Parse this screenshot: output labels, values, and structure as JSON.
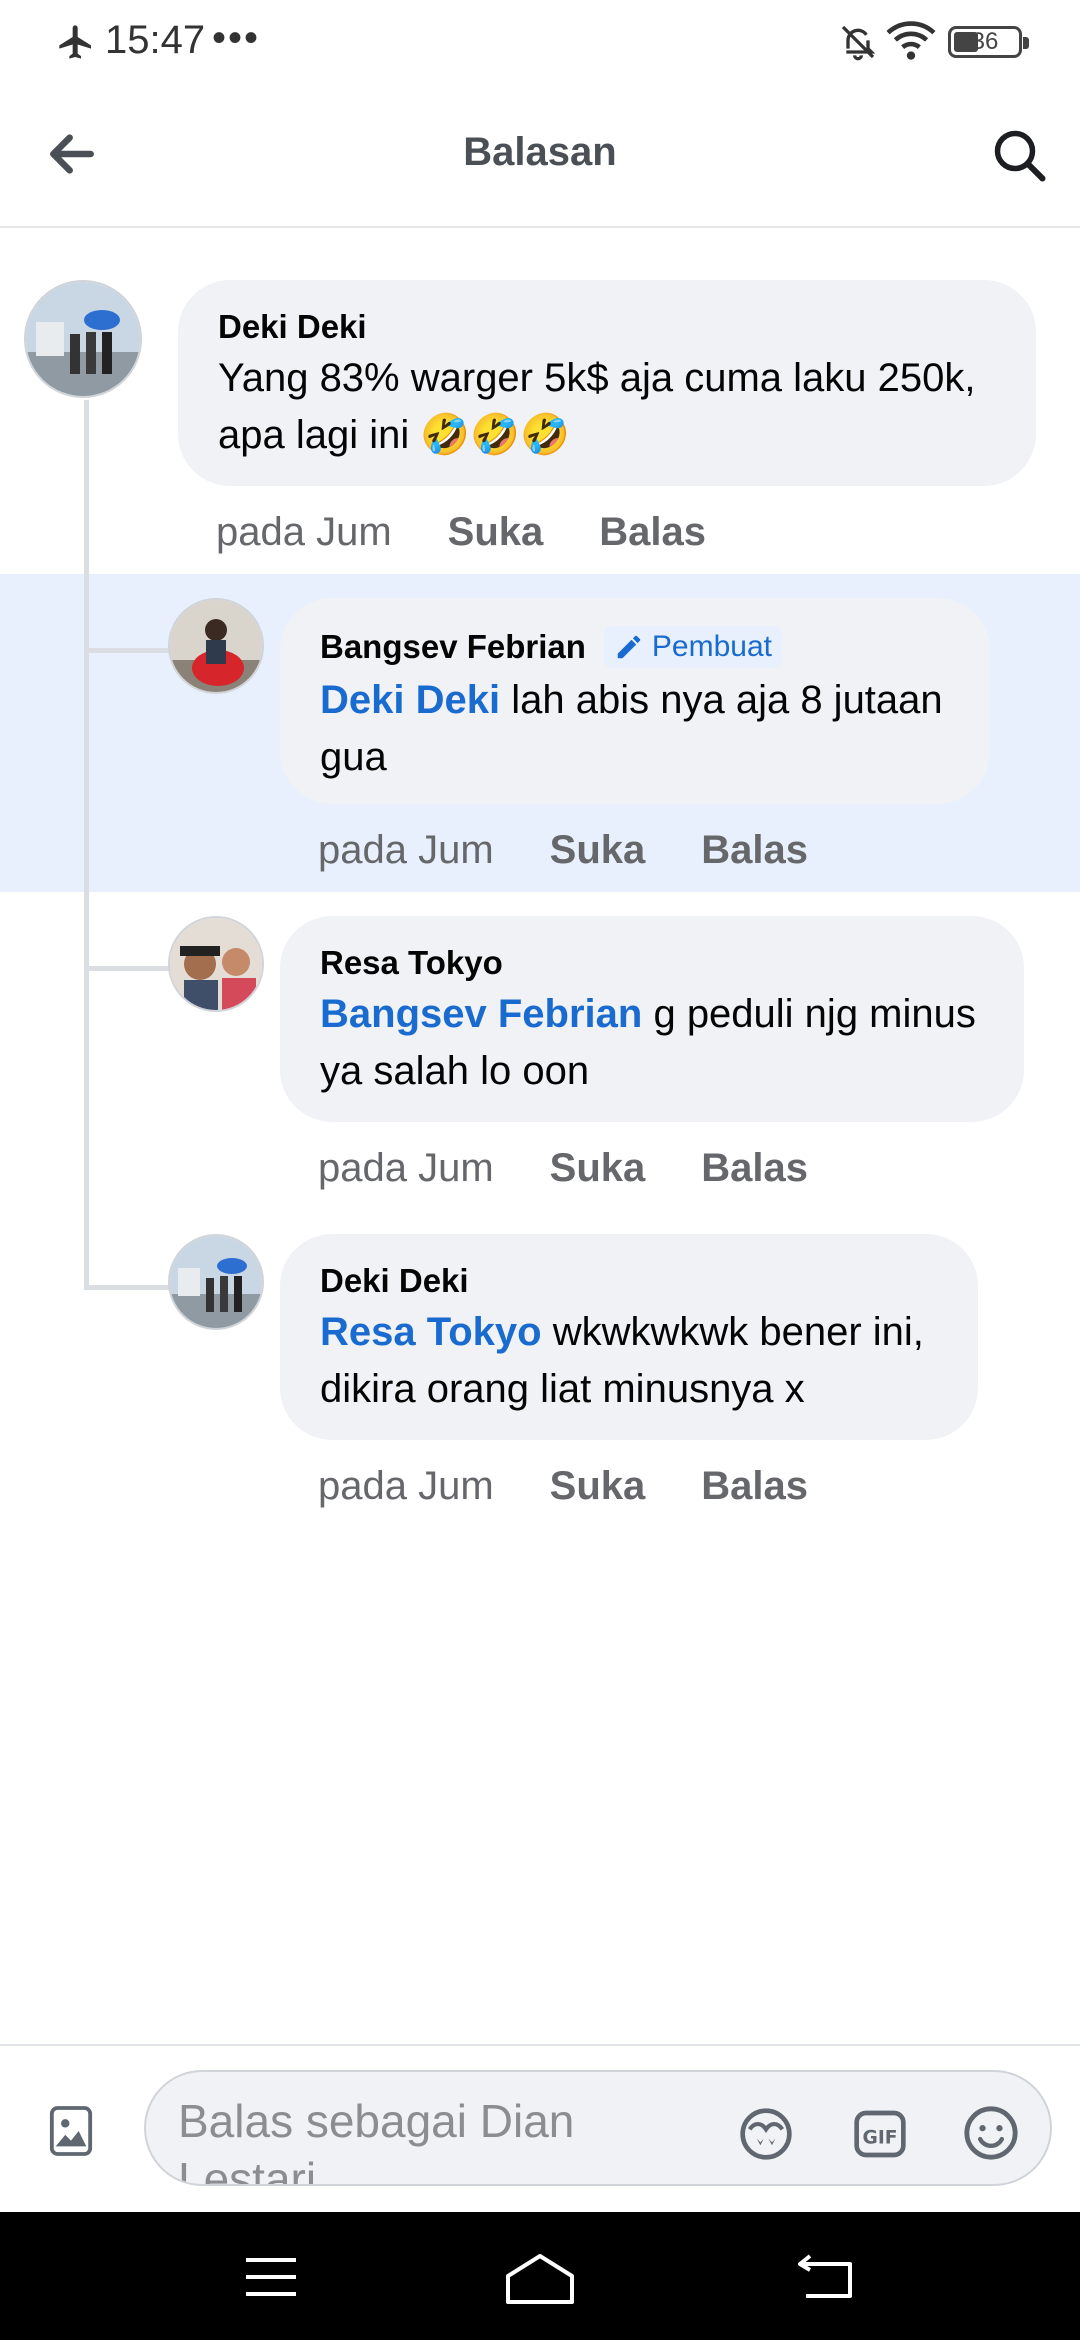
{
  "status_bar": {
    "time": "15:47",
    "dots": "•••",
    "battery": "36"
  },
  "header": {
    "title": "Balasan"
  },
  "comments": [
    {
      "author": "Deki Deki",
      "text": "Yang 83% warger 5k$ aja cuma laku 250k, apa lagi ini 🤣🤣🤣",
      "time": "pada Jum",
      "like": "Suka",
      "reply": "Balas"
    },
    {
      "author": "Bangsev Febrian",
      "badge": "Pembuat",
      "mention": "Deki Deki",
      "text": "lah abis nya aja 8 jutaan gua",
      "time": "pada Jum",
      "like": "Suka",
      "reply": "Balas"
    },
    {
      "author": "Resa Tokyo",
      "mention": "Bangsev Febrian",
      "text": "g peduli njg minus ya salah lo oon",
      "time": "pada Jum",
      "like": "Suka",
      "reply": "Balas"
    },
    {
      "author": "Deki Deki",
      "mention": "Resa Tokyo",
      "text": "wkwkwkwk bener ini, dikira orang liat minusnya x",
      "time": "pada Jum",
      "like": "Suka",
      "reply": "Balas"
    }
  ],
  "composer": {
    "placeholder": "Balas sebagai Dian Lestari"
  },
  "colors": {
    "accent": "#1a6bd0",
    "highlight": "#e7f0fc",
    "bubble": "#f0f2f5"
  }
}
